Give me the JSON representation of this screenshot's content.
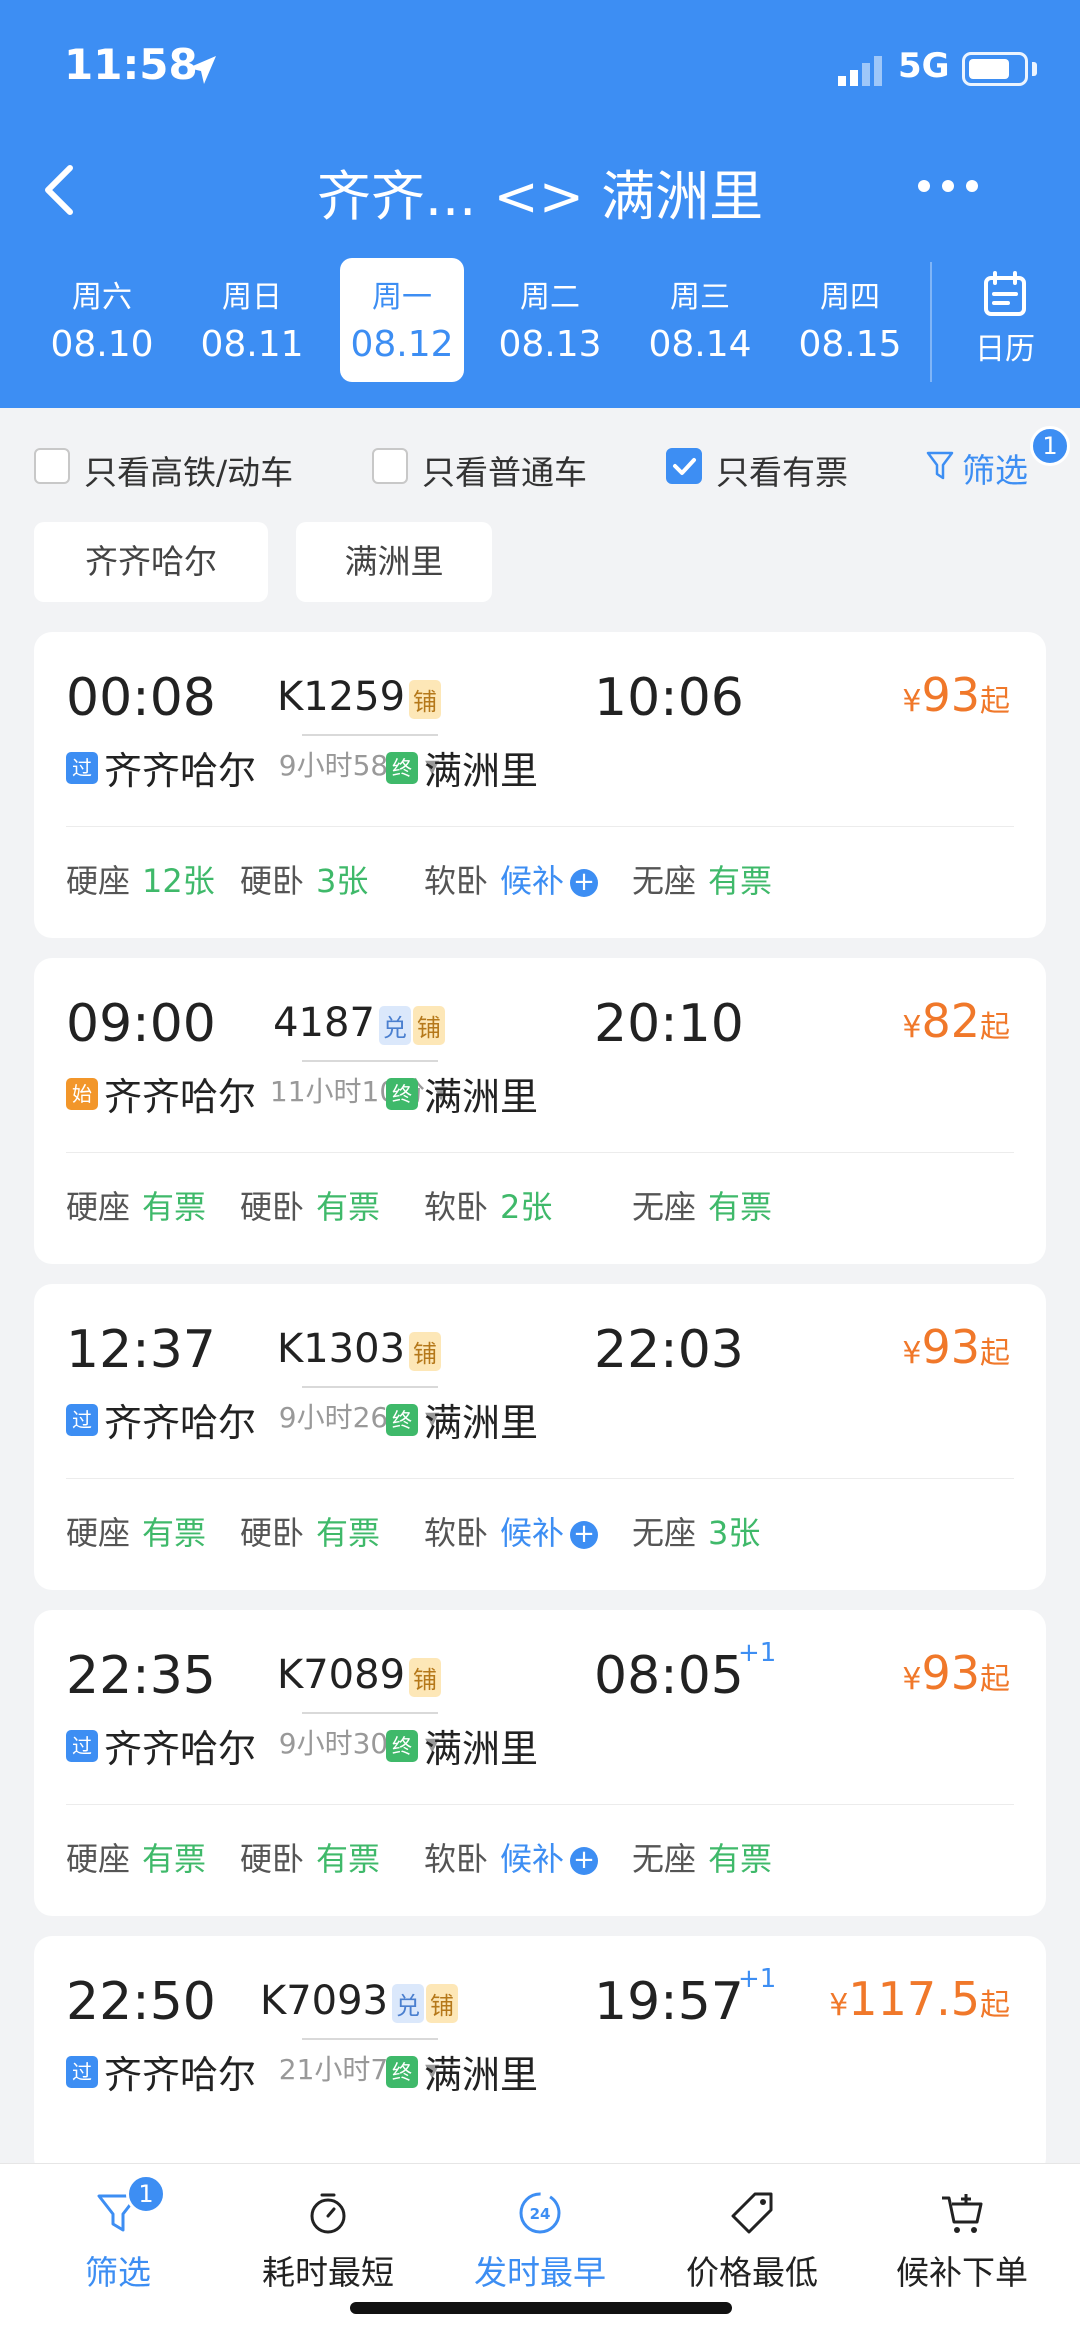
{
  "status": {
    "time": "11:58",
    "network": "5G"
  },
  "nav": {
    "title": "齐齐... <> 满洲里"
  },
  "dates": [
    {
      "weekday": "周六",
      "date": "08.10",
      "active": false
    },
    {
      "weekday": "周日",
      "date": "08.11",
      "active": false
    },
    {
      "weekday": "周一",
      "date": "08.12",
      "active": true
    },
    {
      "weekday": "周二",
      "date": "08.13",
      "active": false
    },
    {
      "weekday": "周三",
      "date": "08.14",
      "active": false
    },
    {
      "weekday": "周四",
      "date": "08.15",
      "active": false
    }
  ],
  "calendar_label": "日历",
  "filters": {
    "gaotie": {
      "label": "只看高铁/动车",
      "checked": false
    },
    "putong": {
      "label": "只看普通车",
      "checked": false
    },
    "youpiao": {
      "label": "只看有票",
      "checked": true
    },
    "screen": {
      "label": "筛选",
      "badge": "1"
    }
  },
  "stations": [
    "齐齐哈尔",
    "满洲里"
  ],
  "trains": [
    {
      "dep": "00:08",
      "arr": "10:06",
      "arr_plus": "",
      "no": "K1259",
      "tags": [
        "铺"
      ],
      "duration": "9小时58分",
      "from_type": "过",
      "from": "齐齐哈尔",
      "to_type": "终",
      "to": "满洲里",
      "price_yen": "¥",
      "price": "93",
      "price_suffix": "起",
      "seats": [
        {
          "name": "硬座",
          "value": "12张",
          "kind": "green"
        },
        {
          "name": "硬卧",
          "value": "3张",
          "kind": "green"
        },
        {
          "name": "软卧",
          "value": "候补",
          "kind": "blue"
        },
        {
          "name": "无座",
          "value": "有票",
          "kind": "green"
        }
      ]
    },
    {
      "dep": "09:00",
      "arr": "20:10",
      "arr_plus": "",
      "no": "4187",
      "tags": [
        "兑",
        "铺"
      ],
      "duration": "11小时10分",
      "from_type": "始",
      "from": "齐齐哈尔",
      "to_type": "终",
      "to": "满洲里",
      "price_yen": "¥",
      "price": "82",
      "price_suffix": "起",
      "seats": [
        {
          "name": "硬座",
          "value": "有票",
          "kind": "green"
        },
        {
          "name": "硬卧",
          "value": "有票",
          "kind": "green"
        },
        {
          "name": "软卧",
          "value": "2张",
          "kind": "green"
        },
        {
          "name": "无座",
          "value": "有票",
          "kind": "green"
        }
      ]
    },
    {
      "dep": "12:37",
      "arr": "22:03",
      "arr_plus": "",
      "no": "K1303",
      "tags": [
        "铺"
      ],
      "duration": "9小时26分",
      "from_type": "过",
      "from": "齐齐哈尔",
      "to_type": "终",
      "to": "满洲里",
      "price_yen": "¥",
      "price": "93",
      "price_suffix": "起",
      "seats": [
        {
          "name": "硬座",
          "value": "有票",
          "kind": "green"
        },
        {
          "name": "硬卧",
          "value": "有票",
          "kind": "green"
        },
        {
          "name": "软卧",
          "value": "候补",
          "kind": "blue"
        },
        {
          "name": "无座",
          "value": "3张",
          "kind": "green"
        }
      ]
    },
    {
      "dep": "22:35",
      "arr": "08:05",
      "arr_plus": "+1",
      "no": "K7089",
      "tags": [
        "铺"
      ],
      "duration": "9小时30分",
      "from_type": "过",
      "from": "齐齐哈尔",
      "to_type": "终",
      "to": "满洲里",
      "price_yen": "¥",
      "price": "93",
      "price_suffix": "起",
      "seats": [
        {
          "name": "硬座",
          "value": "有票",
          "kind": "green"
        },
        {
          "name": "硬卧",
          "value": "有票",
          "kind": "green"
        },
        {
          "name": "软卧",
          "value": "候补",
          "kind": "blue"
        },
        {
          "name": "无座",
          "value": "有票",
          "kind": "green"
        }
      ]
    },
    {
      "dep": "22:50",
      "arr": "19:57",
      "arr_plus": "+1",
      "no": "K7093",
      "tags": [
        "兑",
        "铺"
      ],
      "duration": "21小时7分",
      "from_type": "过",
      "from": "齐齐哈尔",
      "to_type": "终",
      "to": "满洲里",
      "price_yen": "¥",
      "price": "117.5",
      "price_suffix": "起",
      "seats": []
    }
  ],
  "tabs": [
    {
      "label": "筛选",
      "icon": "filter-icon",
      "badge": "1",
      "active": true
    },
    {
      "label": "耗时最短",
      "icon": "stopwatch-icon",
      "active": false
    },
    {
      "label": "发时最早",
      "icon": "clock-24-icon",
      "badge_text": "24",
      "active": true
    },
    {
      "label": "价格最低",
      "icon": "price-tag-icon",
      "active": false
    },
    {
      "label": "候补下单",
      "icon": "cart-plus-icon",
      "active": false
    }
  ],
  "colors": {
    "primary": "#3d8ef3",
    "price": "#f0782a",
    "available": "#3fb96a"
  }
}
